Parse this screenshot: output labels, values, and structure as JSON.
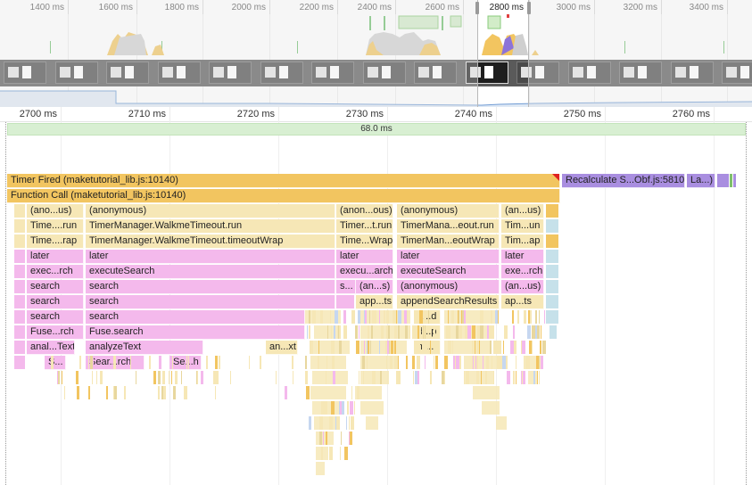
{
  "overview": {
    "ticks": [
      "1400 ms",
      "1600 ms",
      "1800 ms",
      "2000 ms",
      "2200 ms",
      "2400 ms",
      "2600 ms",
      "2800 ms",
      "3000 ms",
      "3200 ms",
      "3400 ms"
    ],
    "selected_tick": "2800 ms"
  },
  "ruler": {
    "ticks": [
      "2700 ms",
      "2710 ms",
      "2720 ms",
      "2730 ms",
      "2740 ms",
      "2750 ms",
      "2760 ms"
    ]
  },
  "selection": {
    "duration": "68.0 ms"
  },
  "flame": {
    "row0": {
      "timer_fired": "Timer Fired (maketutorial_lib.js:10140)",
      "recalculate": "Recalculate S...Obf.js:5810)",
      "layout": "La...)"
    },
    "row1": {
      "function_call": "Function Call (maketutorial_lib.js:10140)"
    },
    "row2": [
      "(ano...us)",
      "(anonymous)",
      "(anon...ous)",
      "(anonymous)",
      "(an...us)"
    ],
    "row3": [
      "Time....run",
      "TimerManager.WalkmeTimeout.run",
      "Timer...t.run",
      "TimerMana...eout.run",
      "Tim...un"
    ],
    "row4": [
      "Time....rap",
      "TimerManager.WalkmeTimeout.timeoutWrap",
      "Time...Wrap",
      "TimerMan...eoutWrap",
      "Tim...ap"
    ],
    "row5": [
      "later",
      "later",
      "later",
      "later",
      "later"
    ],
    "row6": [
      "exec...rch",
      "executeSearch",
      "execu...arch",
      "executeSearch",
      "exe...rch"
    ],
    "row7": [
      "search",
      "search",
      "s...",
      "(an...s)",
      "(anonymous)",
      "(an...us)"
    ],
    "row8": [
      "search",
      "search",
      "app...ts",
      "appendSearchResults",
      "ap...ts"
    ],
    "row9": [
      "search",
      "search",
      "a...d"
    ],
    "row10": [
      "Fuse...rch",
      "Fuse.search",
      "d...p"
    ],
    "row11": [
      "anal...Text",
      "analyzeText",
      "an...xt",
      "m...t"
    ],
    "row12": [
      "S...",
      "Sear...rch",
      "Se...h"
    ]
  },
  "colors": {
    "timer": "#f2c560",
    "yellow_light": "#f6e7b6",
    "pink": "#f4b9ec",
    "purple": "#a98ee0",
    "light_blue": "#c6e1ea",
    "selection_green": "#d8efd2"
  }
}
